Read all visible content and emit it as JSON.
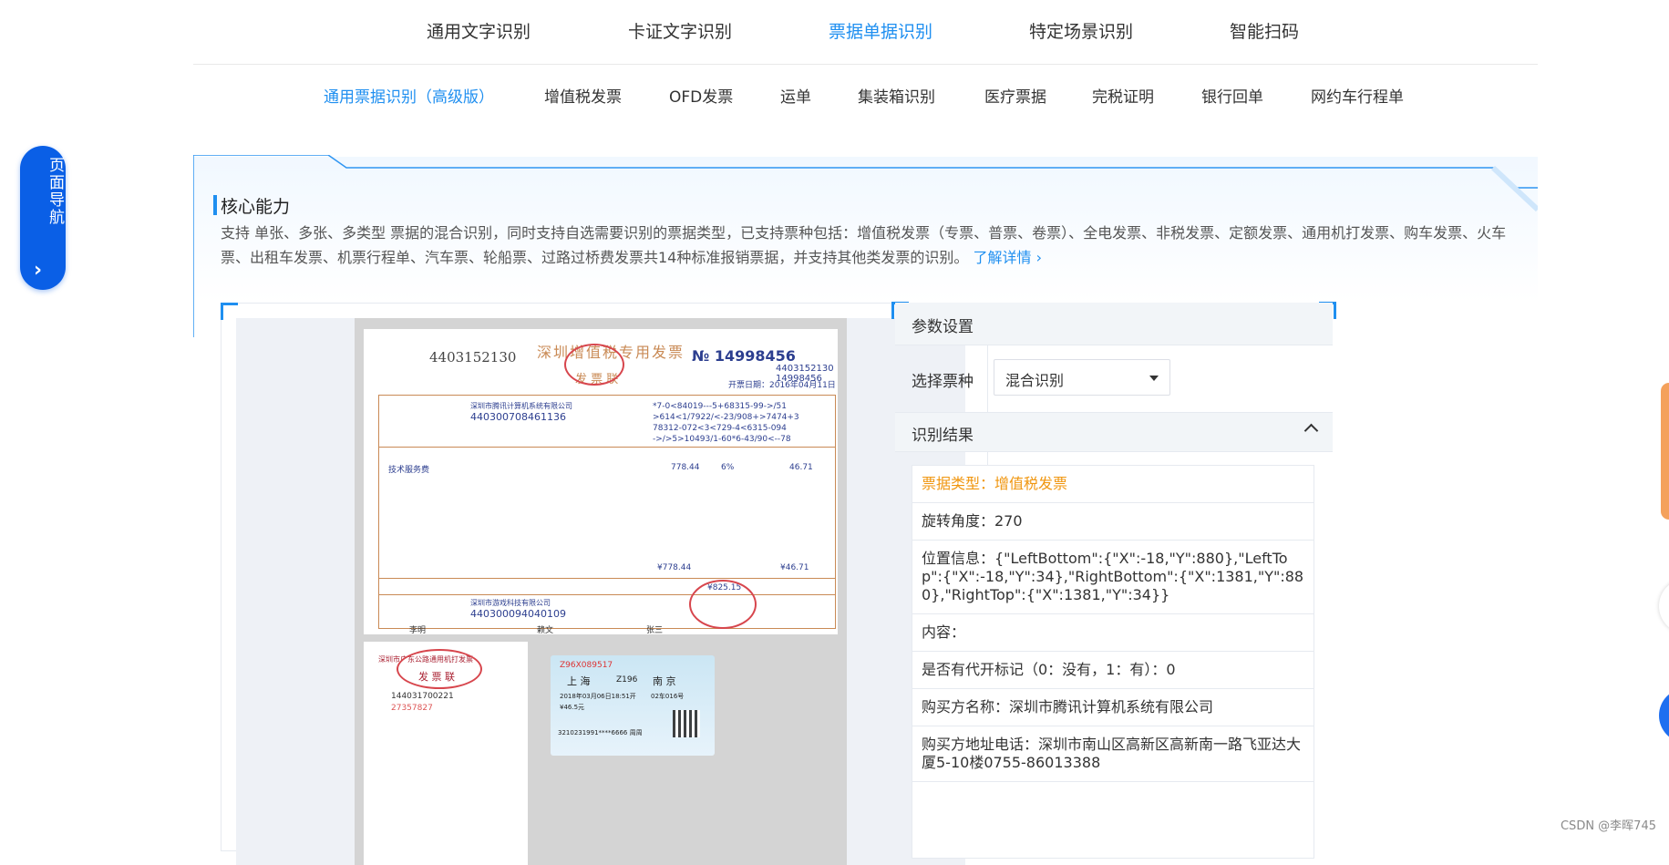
{
  "top_tabs": [
    "通用文字识别",
    "卡证文字识别",
    "票据单据识别",
    "特定场景识别",
    "智能扫码"
  ],
  "sub_tabs": [
    "通用票据识别（高级版）",
    "增值税发票",
    "OFD发票",
    "运单",
    "集装箱识别",
    "医疗票据",
    "完税证明",
    "银行回单",
    "网约车行程单"
  ],
  "page_nav": {
    "label": "页面导航",
    "arrow": "›"
  },
  "core": {
    "title": "核心能力",
    "description": "支持 单张、多张、多类型 票据的混合识别，同时支持自选需要识别的票据类型，已支持票种包括：增值税发票（专票、普票、卷票）、全电发票、非税发票、定额发票、通用机打发票、购车发票、火车票、出租车发票、机票行程单、汽车票、轮船票、过路过桥费发票共14种标准报销票据，并支持其他类发票的识别。",
    "learn_more": "了解详情"
  },
  "invoice_sample": {
    "code": "4403152130",
    "title": "深圳增值税专用发票",
    "subtitle": "发 票 联",
    "number": "№ 14998456",
    "number_small": "4403152130 14998456",
    "date": "开票日期：2016年04月11日",
    "buyer_name": "深圳市腾讯计算机系统有限公司",
    "buyer_tax_id": "440300708461136",
    "crypto_1": "*7-0<84019---5+68315-99->/51",
    "crypto_2": ">614<1/7922/<-23/908+>7474+3",
    "crypto_3": "78312-072<3<729-4<6315-094",
    "crypto_4": "->/>5>10493/1-60*6-43/90<--78",
    "item": "技术服务费",
    "amount": "778.44",
    "tax_rate": "6%",
    "tax": "46.71",
    "total_amount": "¥778.44",
    "total_tax": "¥46.71",
    "grand_total": "¥825.15",
    "seller_name": "深圳市游戏科技有限公司",
    "seller_tax_id": "440300094040109",
    "payee": "李明",
    "reviewer": "赖文",
    "drawer": "张三"
  },
  "receipt_sample": {
    "title": "深圳市广东公路通用机打发票",
    "subtitle": "发 票 联",
    "code": "144031700221",
    "number": "27357827"
  },
  "ticket_sample": {
    "code": "Z96X089517",
    "from": "上 海",
    "train": "Z196",
    "to": "南 京",
    "date": "2018年03月06日18:51开",
    "seat": "02车016号",
    "price": "¥46.5元",
    "id": "3210231991****6666 周周"
  },
  "params": {
    "header": "参数设置",
    "select_label": "选择票种",
    "select_value": "混合识别",
    "result_header": "识别结果"
  },
  "results": [
    "票据类型：增值税发票",
    "旋转角度：270",
    "位置信息：{\"LeftBottom\":{\"X\":-18,\"Y\":880},\"LeftTop\":{\"X\":-18,\"Y\":34},\"RightBottom\":{\"X\":1381,\"Y\":880},\"RightTop\":{\"X\":1381,\"Y\":34}}",
    "内容：",
    "是否有代开标记（0：没有，1：有）：0",
    "购买方名称：深圳市腾讯计算机系统有限公司",
    "购买方地址电话：深圳市南山区高新区高新南一路飞亚达大厦5-10楼0755-86013388"
  ],
  "watermark": "CSDN @李晖745",
  "colors": {
    "accent": "#1f8ff0",
    "nav_blue": "#0a5fe6",
    "result_type": "#f0960f"
  }
}
